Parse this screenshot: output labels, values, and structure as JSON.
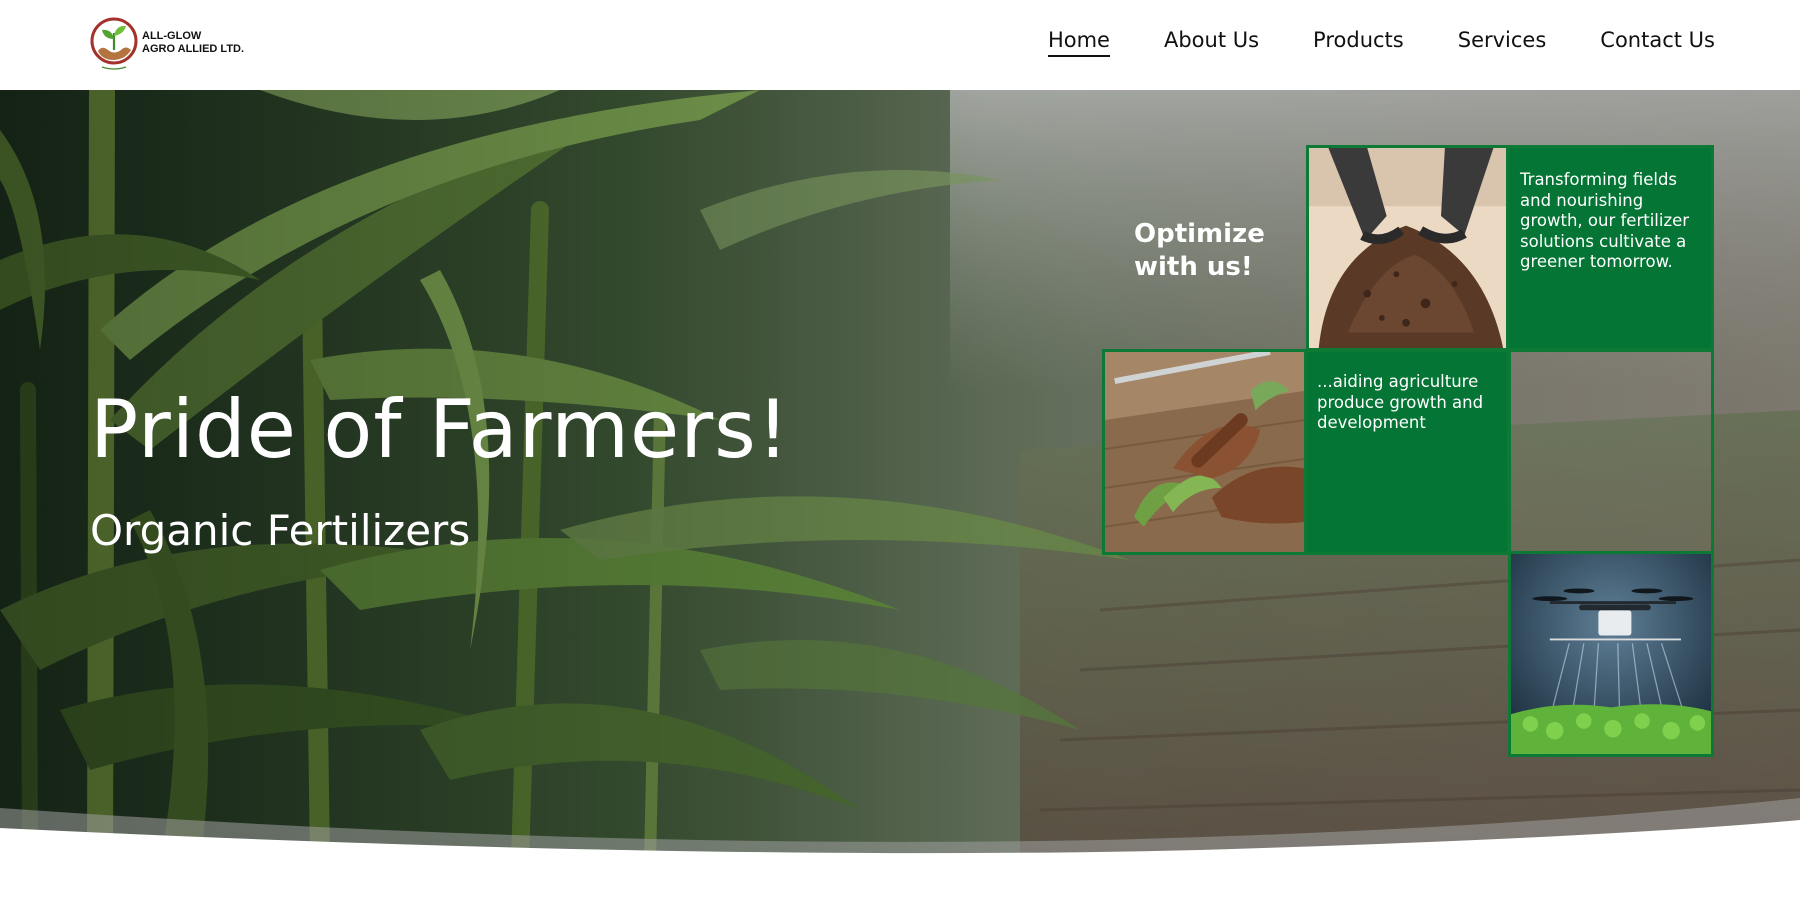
{
  "header": {
    "logo": {
      "line1": "ALL-GLOW",
      "line2": "AGRO ALLIED LTD.",
      "icon": "leaf-in-hands-icon"
    },
    "nav": [
      {
        "label": "Home",
        "active": true
      },
      {
        "label": "About Us",
        "active": false
      },
      {
        "label": "Products",
        "active": false
      },
      {
        "label": "Services",
        "active": false
      },
      {
        "label": "Contact Us",
        "active": false
      }
    ]
  },
  "hero": {
    "title": "Pride of Farmers!",
    "subtitle": "Organic Fertilizers",
    "background": "corn-field-photo",
    "tagline": "Optimize with us!",
    "tiles": {
      "soil_image": "hands-holding-soil-photo",
      "fertilizer_text": "Transforming fields and nourishing growth, our fertilizer solutions cultivate a greener tomorrow.",
      "planting_image": "hands-planting-seedling-photo",
      "agriculture_text": "...aiding agriculture produce growth and development",
      "drone_image": "crop-spraying-drone-photo"
    }
  },
  "colors": {
    "brand_green": "#047535",
    "tile_border": "#0c7a35",
    "nav_text": "#111111",
    "hero_text": "#ffffff"
  }
}
